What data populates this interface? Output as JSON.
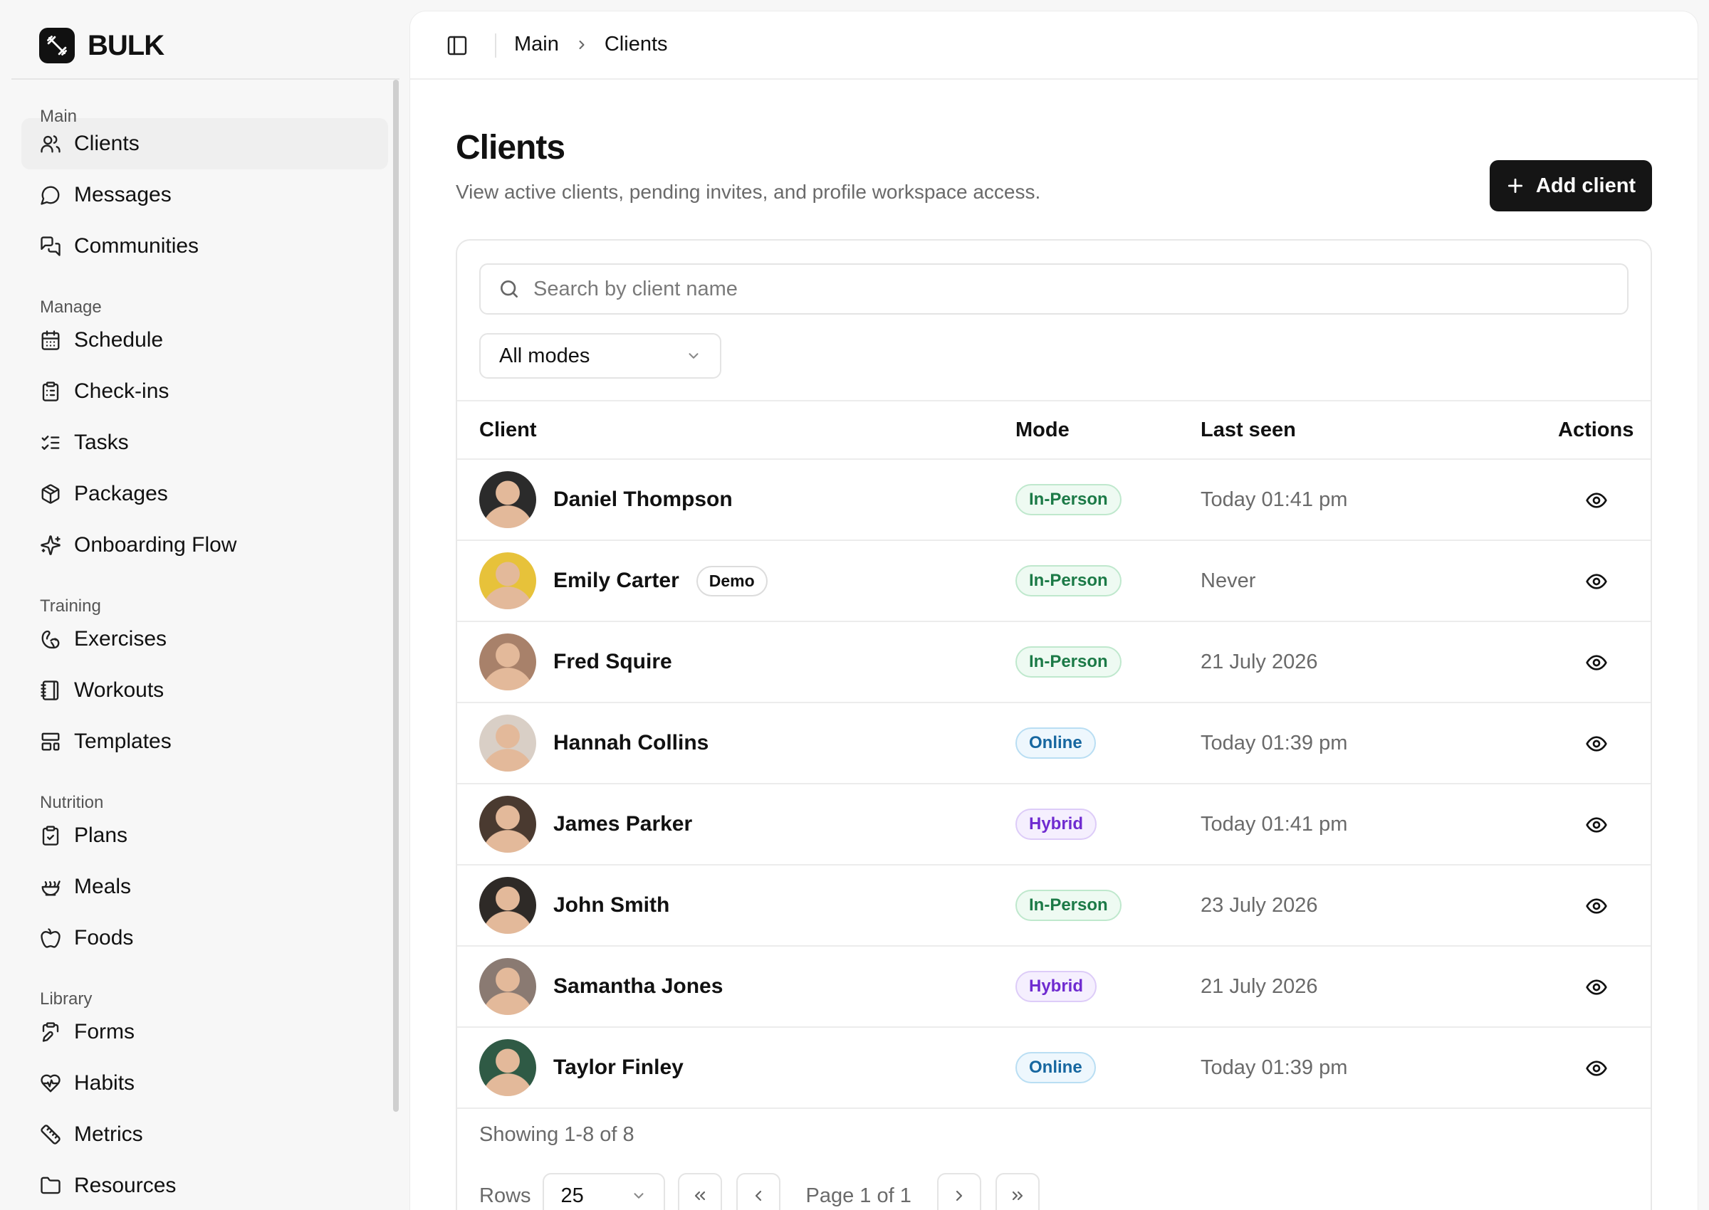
{
  "brand": {
    "name": "BULK"
  },
  "sidebar": {
    "sections": [
      {
        "title": "Main",
        "items": [
          {
            "label": "Clients",
            "icon": "users-icon",
            "active": true
          },
          {
            "label": "Messages",
            "icon": "message-circle-icon"
          },
          {
            "label": "Communities",
            "icon": "messages-square-icon"
          }
        ]
      },
      {
        "title": "Manage",
        "items": [
          {
            "label": "Schedule",
            "icon": "calendar-icon"
          },
          {
            "label": "Check-ins",
            "icon": "clipboard-list-icon"
          },
          {
            "label": "Tasks",
            "icon": "list-checks-icon"
          },
          {
            "label": "Packages",
            "icon": "package-icon"
          },
          {
            "label": "Onboarding Flow",
            "icon": "sparkles-icon"
          }
        ]
      },
      {
        "title": "Training",
        "items": [
          {
            "label": "Exercises",
            "icon": "biceps-icon"
          },
          {
            "label": "Workouts",
            "icon": "notebook-icon"
          },
          {
            "label": "Templates",
            "icon": "layout-template-icon"
          }
        ]
      },
      {
        "title": "Nutrition",
        "items": [
          {
            "label": "Plans",
            "icon": "clipboard-check-icon"
          },
          {
            "label": "Meals",
            "icon": "soup-icon"
          },
          {
            "label": "Foods",
            "icon": "apple-icon"
          }
        ]
      },
      {
        "title": "Library",
        "items": [
          {
            "label": "Forms",
            "icon": "clipboard-pen-icon"
          },
          {
            "label": "Habits",
            "icon": "heart-pulse-icon"
          },
          {
            "label": "Metrics",
            "icon": "ruler-icon"
          },
          {
            "label": "Resources",
            "icon": "folder-icon"
          }
        ]
      }
    ]
  },
  "topbar": {
    "breadcrumb": [
      "Main",
      "Clients"
    ]
  },
  "page": {
    "title": "Clients",
    "subtitle": "View active clients, pending invites, and profile workspace access.",
    "add_button": "Add client"
  },
  "filters": {
    "search_placeholder": "Search by client name",
    "mode_select": "All modes"
  },
  "table": {
    "columns": [
      "Client",
      "Mode",
      "Last seen",
      "Actions"
    ],
    "rows": [
      {
        "name": "Daniel Thompson",
        "mode": "In-Person",
        "mode_key": "in-person",
        "last_seen": "Today 01:41 pm",
        "avatar_color": "#2b2b2b"
      },
      {
        "name": "Emily Carter",
        "tag": "Demo",
        "mode": "In-Person",
        "mode_key": "in-person",
        "last_seen": "Never",
        "avatar_color": "#e7c23a"
      },
      {
        "name": "Fred Squire",
        "mode": "In-Person",
        "mode_key": "in-person",
        "last_seen": "21 July 2026",
        "avatar_color": "#a8816a"
      },
      {
        "name": "Hannah Collins",
        "mode": "Online",
        "mode_key": "online",
        "last_seen": "Today 01:39 pm",
        "avatar_color": "#d9cfc6"
      },
      {
        "name": "James Parker",
        "mode": "Hybrid",
        "mode_key": "hybrid",
        "last_seen": "Today 01:41 pm",
        "avatar_color": "#4a3a30"
      },
      {
        "name": "John Smith",
        "mode": "In-Person",
        "mode_key": "in-person",
        "last_seen": "23 July 2026",
        "avatar_color": "#2e2a27"
      },
      {
        "name": "Samantha Jones",
        "mode": "Hybrid",
        "mode_key": "hybrid",
        "last_seen": "21 July 2026",
        "avatar_color": "#8a7a72"
      },
      {
        "name": "Taylor Finley",
        "mode": "Online",
        "mode_key": "online",
        "last_seen": "Today 01:39 pm",
        "avatar_color": "#2f5a45"
      }
    ]
  },
  "footer": {
    "showing": "Showing 1-8 of 8",
    "rows_label": "Rows",
    "rows_value": "25",
    "page_text": "Page 1 of 1"
  }
}
